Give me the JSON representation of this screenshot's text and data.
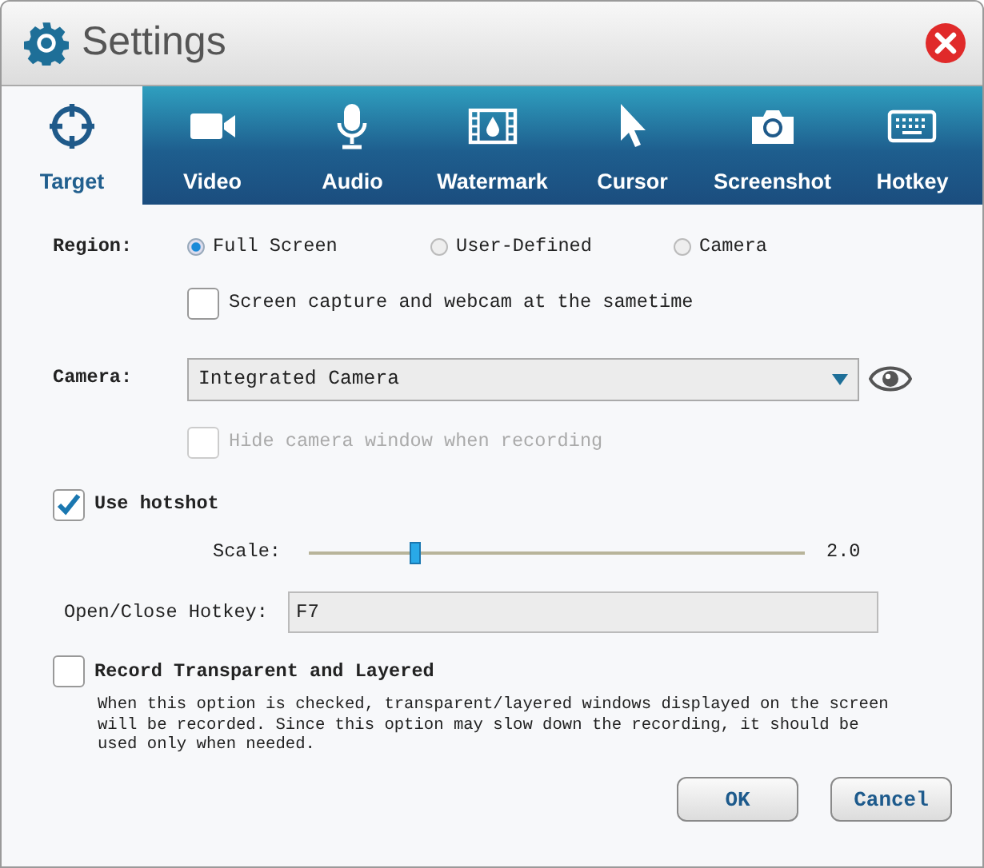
{
  "window": {
    "title": "Settings"
  },
  "tabs": [
    {
      "label": "Target",
      "kind": "target",
      "selected": true
    },
    {
      "label": "Video",
      "kind": "video",
      "selected": false
    },
    {
      "label": "Audio",
      "kind": "audio",
      "selected": false
    },
    {
      "label": "Watermark",
      "kind": "watermark",
      "selected": false
    },
    {
      "label": "Cursor",
      "kind": "cursor",
      "selected": false
    },
    {
      "label": "Screenshot",
      "kind": "screenshot",
      "selected": false
    },
    {
      "label": "Hotkey",
      "kind": "hotkey",
      "selected": false
    }
  ],
  "form": {
    "region": {
      "label": "Region:",
      "options": [
        {
          "label": "Full Screen",
          "selected": true
        },
        {
          "label": "User-Defined",
          "selected": false
        },
        {
          "label": "Camera",
          "selected": false
        }
      ]
    },
    "simultaneous": {
      "label": "Screen capture and webcam at the sametime",
      "checked": false,
      "disabled": false
    },
    "camera": {
      "label": "Camera:",
      "value": "Integrated Camera"
    },
    "hide_camera": {
      "label": "Hide camera window when recording",
      "checked": false,
      "disabled": true
    },
    "hotshot": {
      "label": "Use hotshot",
      "checked": true,
      "disabled": false
    },
    "scale": {
      "label": "Scale:",
      "level": 0.21,
      "reading": "2.0"
    },
    "hotkey": {
      "label": "Open/Close Hotkey:",
      "value": "F7"
    },
    "transparent": {
      "label": "Record Transparent and Layered",
      "checked": false,
      "disabled": false,
      "description": "When this option is checked, transparent/layered windows displayed on the screen will be recorded. Since this option may slow down the recording, it should be used only when needed."
    }
  },
  "buttons": [
    "OK",
    "Cancel"
  ]
}
